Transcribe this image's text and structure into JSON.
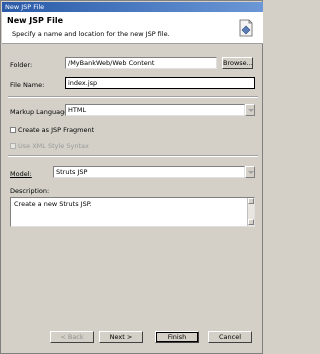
{
  "window": {
    "title": "New JSP File"
  },
  "header": {
    "title": "New JSP File",
    "description": "Specify a name and location for the new JSP file."
  },
  "form": {
    "folder_label": "Folder:",
    "folder_value": "/MyBankWeb/Web Content",
    "browse_label": "Browse...",
    "filename_label": "File Name:",
    "filename_value": "index.jsp",
    "markup_label": "Markup Language:",
    "markup_value": "HTML",
    "fragment_label": "Create as JSP Fragment",
    "xml_syntax_label": "Use XML Style Syntax",
    "model_label": "Model:",
    "model_value": "Struts JSP",
    "description_label": "Description:",
    "description_value": "Create a new Struts JSP."
  },
  "buttons": {
    "back": "< Back",
    "next": "Next >",
    "finish": "Finish",
    "cancel": "Cancel"
  }
}
